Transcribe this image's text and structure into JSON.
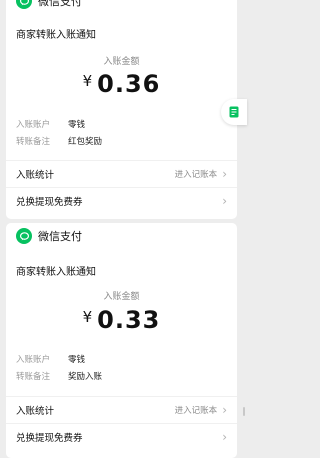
{
  "cards": [
    {
      "pay_name": "微信支付",
      "notice_title": "商家转账入账通知",
      "amount_label": "入账金额",
      "currency": "¥",
      "amount": "0.36",
      "account_key": "入账账户",
      "account_val": "零钱",
      "remark_key": "转账备注",
      "remark_val": "红包奖励",
      "stats_label": "入账统计",
      "stats_link": "进入记账本",
      "exchange_label": "兑换提现免费券"
    },
    {
      "pay_name": "微信支付",
      "notice_title": "商家转账入账通知",
      "amount_label": "入账金额",
      "currency": "¥",
      "amount": "0.33",
      "account_key": "入账账户",
      "account_val": "零钱",
      "remark_key": "转账备注",
      "remark_val": "奖励入账",
      "stats_label": "入账统计",
      "stats_link": "进入记账本",
      "exchange_label": "兑换提现免费券"
    }
  ],
  "floating_icon": "green-document-icon",
  "colors": {
    "background": "#ededed",
    "card": "#ffffff",
    "wechat_green": "#07c160",
    "muted_text": "#8a8a8a"
  }
}
